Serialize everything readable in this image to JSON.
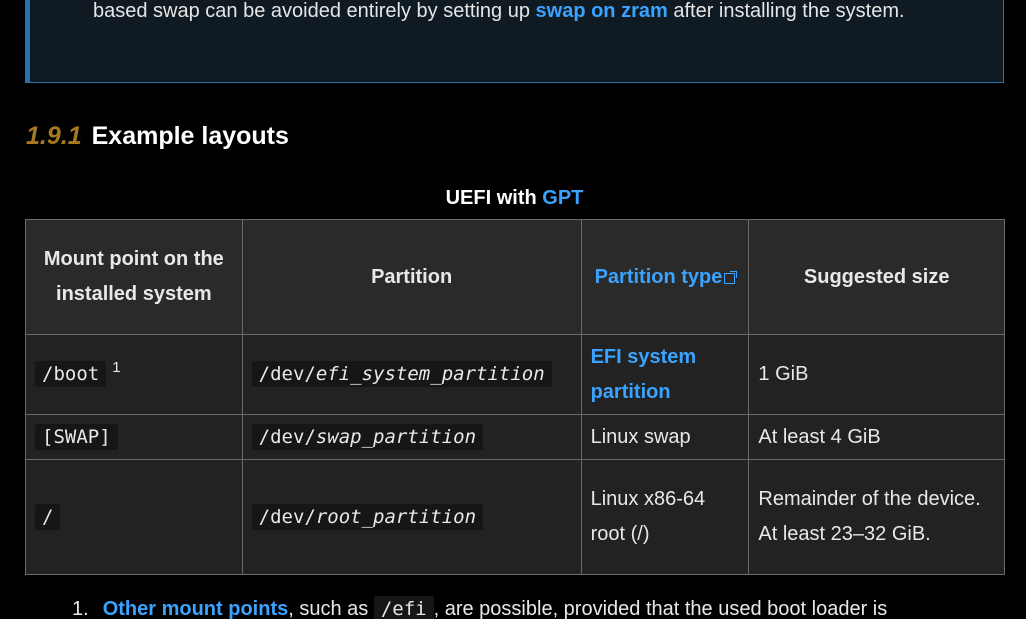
{
  "note": {
    "text_before": "based swap can be avoided entirely by setting up ",
    "link": "swap on zram",
    "text_after": " after installing the system."
  },
  "heading": {
    "number": "1.9.1",
    "title": "Example layouts"
  },
  "caption": {
    "prefix": "UEFI with ",
    "link": "GPT"
  },
  "table": {
    "headers": {
      "mount": "Mount point on the installed system",
      "partition": "Partition",
      "type": "Partition type",
      "size": "Suggested size"
    },
    "rows": [
      {
        "mount": "/boot",
        "mount_sup": "1",
        "partition_prefix": "/dev/",
        "partition_var": "efi_system_partition",
        "type": "EFI system partition",
        "size": "1 GiB"
      },
      {
        "mount": "[SWAP]",
        "partition_prefix": "/dev/",
        "partition_var": "swap_partition",
        "type": "Linux swap",
        "size": "At least 4 GiB"
      },
      {
        "mount": "/",
        "partition_prefix": "/dev/",
        "partition_var": "root_partition",
        "type": "Linux x86-64 root (/)",
        "size": "Remainder of the device. At least 23–32 GiB."
      }
    ]
  },
  "footnote": {
    "number": "1.",
    "link": "Other mount points",
    "text1": ", such as ",
    "code": "/efi",
    "text2": ", are possible, provided that the used boot loader is"
  },
  "colors": {
    "background": "#000000",
    "link": "#3aa3ff",
    "section_number": "#a77a1f",
    "note_border": "#2e6fa7"
  },
  "icons": {
    "external_link": "external-link-icon"
  }
}
